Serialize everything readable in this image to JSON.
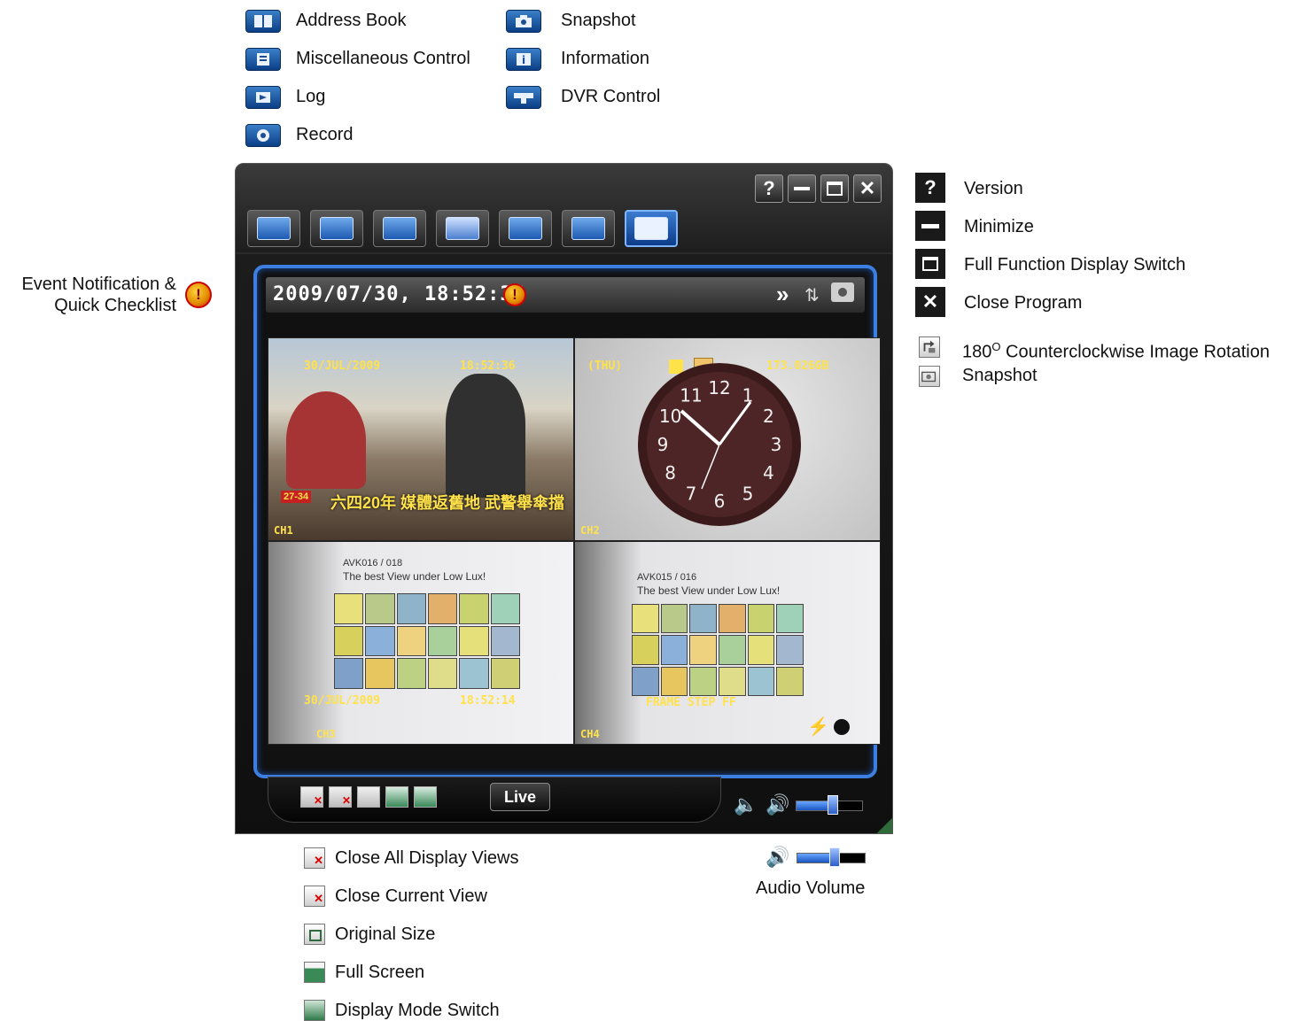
{
  "top_legend": {
    "left": [
      {
        "icon": "address-book-icon",
        "label": "Address Book"
      },
      {
        "icon": "miscellaneous-control-icon",
        "label": "Miscellaneous Control"
      },
      {
        "icon": "log-icon",
        "label": "Log"
      },
      {
        "icon": "record-icon",
        "label": "Record"
      }
    ],
    "right": [
      {
        "icon": "snapshot-icon",
        "label": "Snapshot"
      },
      {
        "icon": "information-icon",
        "label": "Information"
      },
      {
        "icon": "dvr-control-icon",
        "label": "DVR Control"
      }
    ]
  },
  "left_note": {
    "line1": "Event Notification &",
    "line2": "Quick Checklist",
    "icon_glyph": "!"
  },
  "right_legend": [
    {
      "icon": "help-icon",
      "glyph": "?",
      "label": "Version"
    },
    {
      "icon": "minimize-icon",
      "glyph": "—",
      "label": "Minimize"
    },
    {
      "icon": "full-function-icon",
      "glyph": "□",
      "label": "Full Function Display Switch"
    },
    {
      "icon": "close-icon",
      "glyph": "✕",
      "label": "Close Program"
    }
  ],
  "right_legend_small": {
    "rotation_prefix": "180",
    "rotation_sup": "O",
    "rotation_label": " Counterclockwise Image Rotation",
    "snapshot_label": "Snapshot"
  },
  "window": {
    "toolbar": [
      "address-book",
      "miscellaneous-control",
      "log",
      "record",
      "snapshot",
      "information",
      "dvr-control"
    ],
    "active_tool": "dvr-control",
    "title_buttons": [
      "?",
      "▬",
      "▭",
      "✕"
    ],
    "timestamp": "2009/07/30, 18:52:36",
    "header_icons": {
      "forward": "»",
      "rotate": "⇅",
      "snapshot": "◙"
    },
    "cameras": {
      "ch1": {
        "label": "CH1",
        "osd_date": "30/JUL/2009",
        "osd_time": "18:52:36",
        "caption": "六四20年 媒體返舊地 武警舉傘擋",
        "badge": "27-34"
      },
      "ch2": {
        "label": "CH2",
        "osd_day": "(THU)",
        "osd_storage": "173.026GB",
        "clock": [
          "12",
          "1",
          "2",
          "3",
          "4",
          "5",
          "6",
          "7",
          "8",
          "9",
          "10",
          "11"
        ]
      },
      "ch3": {
        "label": "CH3",
        "sign1": "AVK016 / 018",
        "sign2": "The best View under Low Lux!",
        "osd_date": "30/JUL/2009",
        "osd_time": "18:52:14"
      },
      "ch4": {
        "label": "CH4",
        "sign1": "AVK015 / 016",
        "sign2": "The best View under Low Lux!",
        "osd_status": "FRAME STEP FF"
      }
    },
    "live_label": "Live",
    "volume_level": 0.55
  },
  "bottom_legend": [
    {
      "icon": "close-all-views-icon",
      "label": "Close All Display Views"
    },
    {
      "icon": "close-current-view-icon",
      "label": "Close Current View"
    },
    {
      "icon": "original-size-icon",
      "label": "Original Size"
    },
    {
      "icon": "full-screen-icon",
      "label": "Full Screen"
    },
    {
      "icon": "display-mode-switch-icon",
      "label": "Display Mode Switch"
    }
  ],
  "audio_volume_label": "Audio Volume",
  "colors": {
    "accent_blue": "#3d7fe0",
    "alert_red": "#cc0000",
    "osd_yellow": "#ffe24a"
  }
}
